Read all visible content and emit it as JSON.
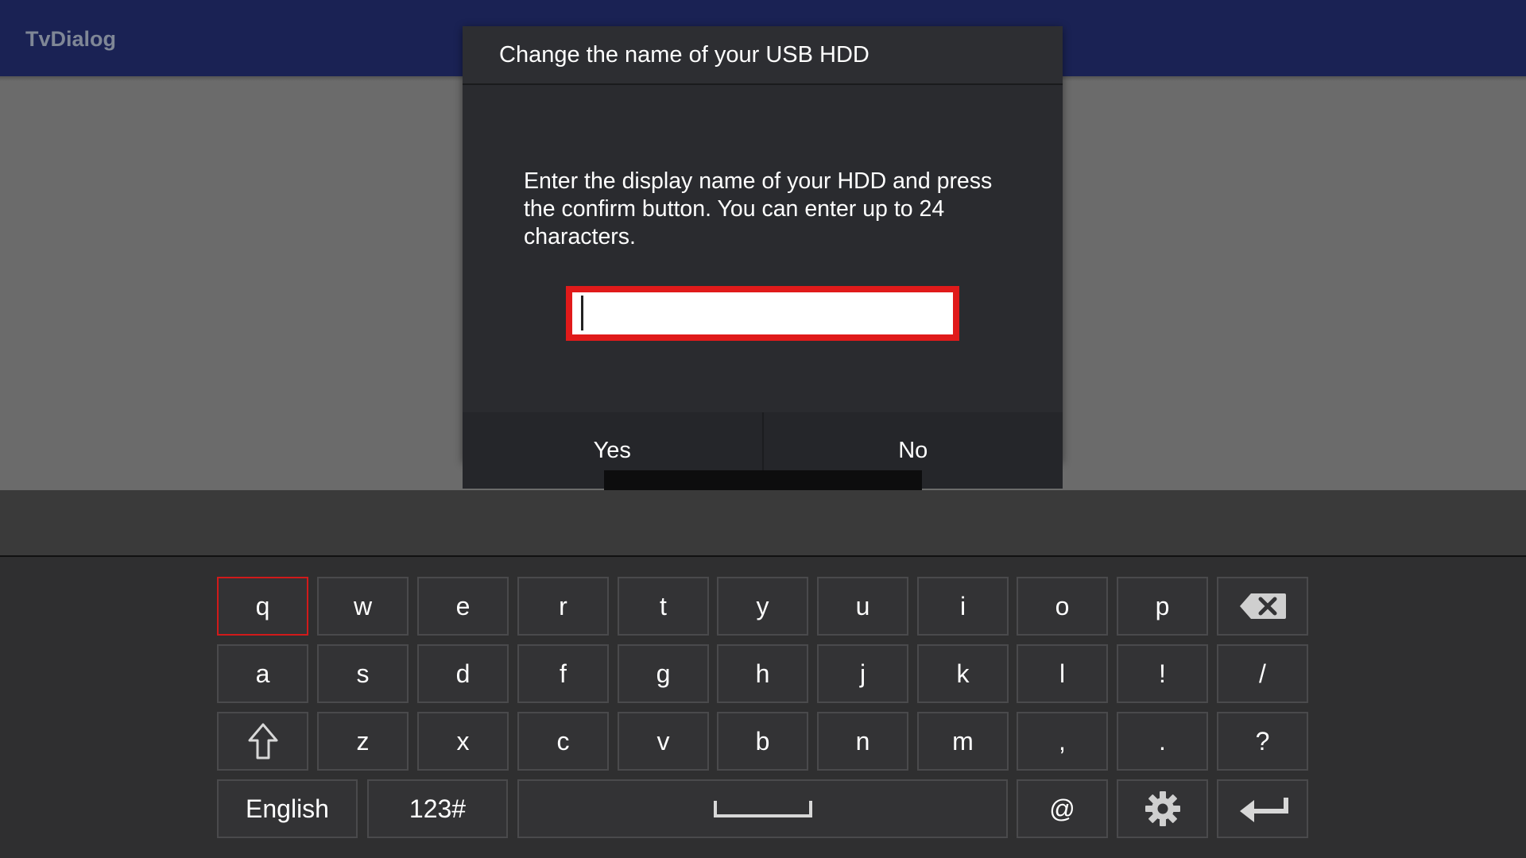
{
  "app": {
    "title": "TvDialog"
  },
  "dialog": {
    "title": "Change the name of your USB HDD",
    "message": "Enter the display name of your HDD and press the confirm button. You can enter up to 24 characters.",
    "input_value": "",
    "buttons": {
      "yes": "Yes",
      "no": "No"
    }
  },
  "keyboard": {
    "row1": [
      "q",
      "w",
      "e",
      "r",
      "t",
      "y",
      "u",
      "i",
      "o",
      "p"
    ],
    "row2": [
      "a",
      "s",
      "d",
      "f",
      "g",
      "h",
      "j",
      "k",
      "l",
      "!",
      "/"
    ],
    "row3": [
      "z",
      "x",
      "c",
      "v",
      "b",
      "n",
      "m",
      ",",
      ".",
      "?"
    ],
    "row4": {
      "language": "English",
      "symbols": "123#",
      "at": "@"
    },
    "icons": {
      "backspace": "backspace-icon",
      "shift": "shift-icon",
      "space": "space-bar-icon",
      "settings": "gear-icon",
      "enter": "enter-icon"
    },
    "selected_key": "q",
    "accent_color": "#e01a1a"
  }
}
